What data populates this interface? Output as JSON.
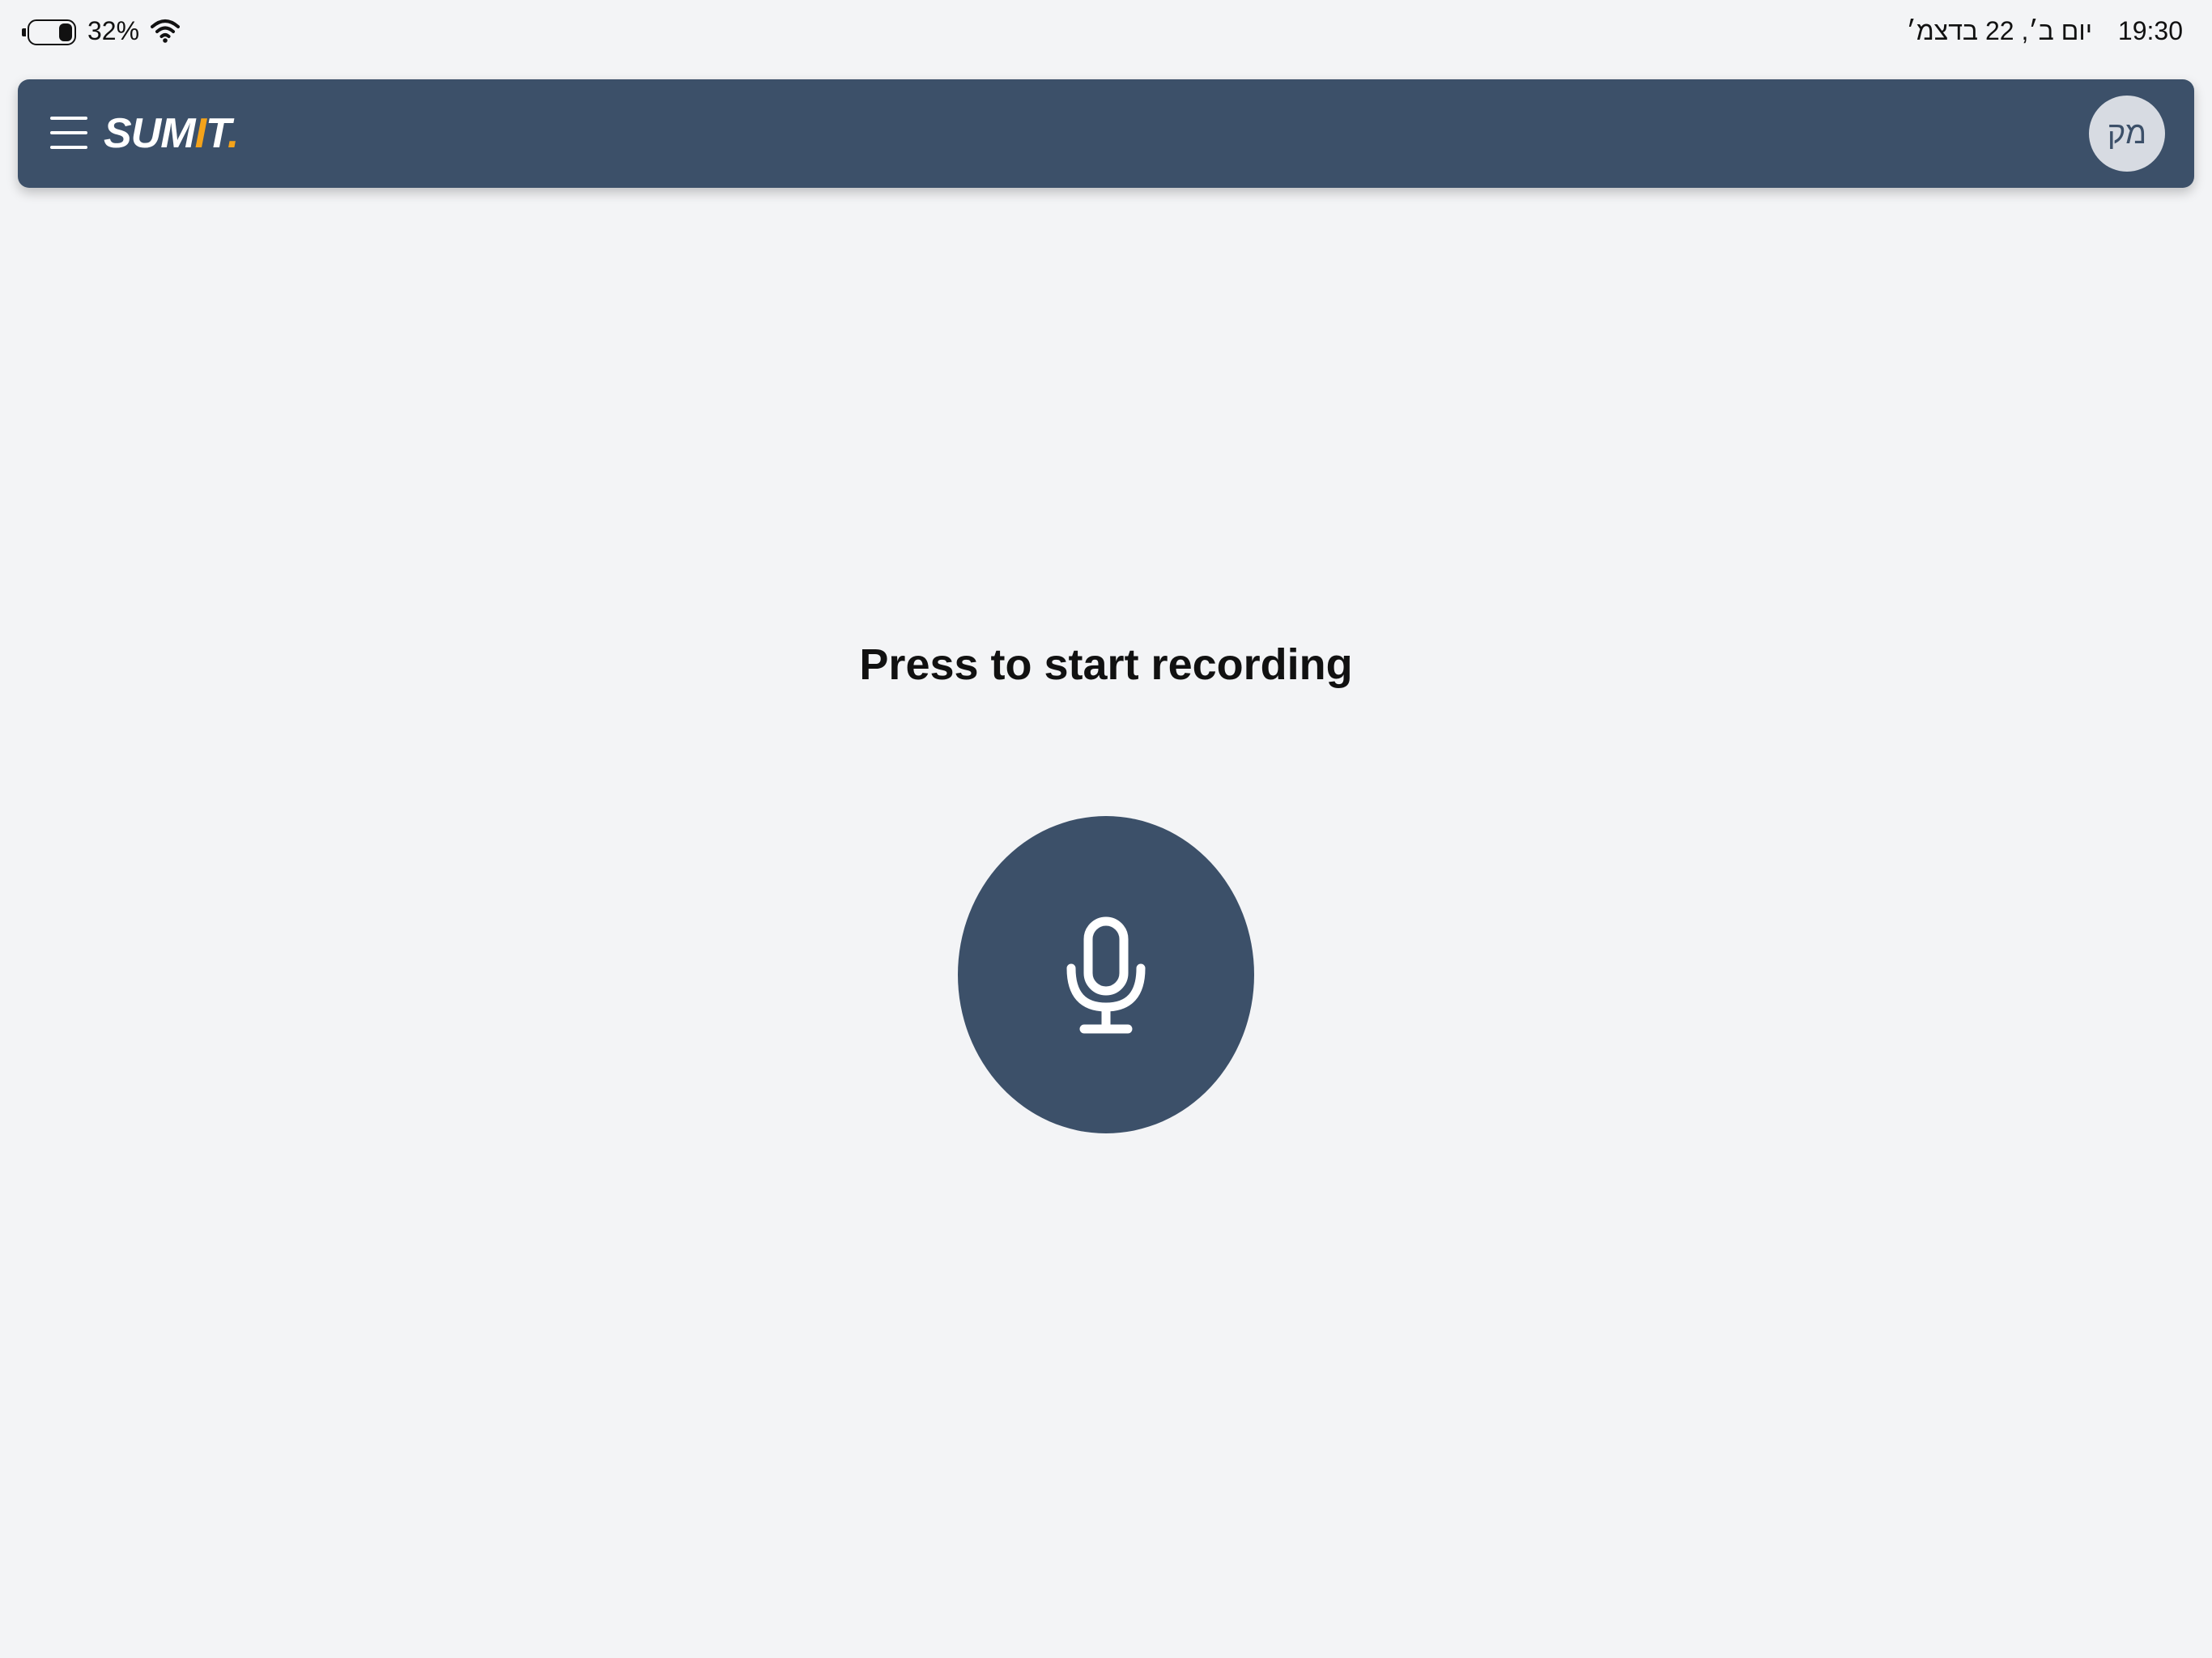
{
  "status_bar": {
    "battery_percent": "32%",
    "battery_level": 0.32,
    "time": "19:30",
    "date": "יום ב׳, 22 בדצמ׳"
  },
  "header": {
    "logo_main": "SUM",
    "logo_accent_i": "I",
    "logo_tail": "T",
    "logo_dot": ".",
    "avatar_initials": "מק"
  },
  "main": {
    "prompt": "Press to start recording"
  },
  "colors": {
    "primary": "#3c5069",
    "accent": "#f5a31a",
    "background": "#f3f4f6",
    "avatar_bg": "#d7dbe2"
  },
  "icons": {
    "menu": "hamburger-menu-icon",
    "record": "microphone-icon",
    "wifi": "wifi-icon",
    "battery": "battery-icon"
  }
}
